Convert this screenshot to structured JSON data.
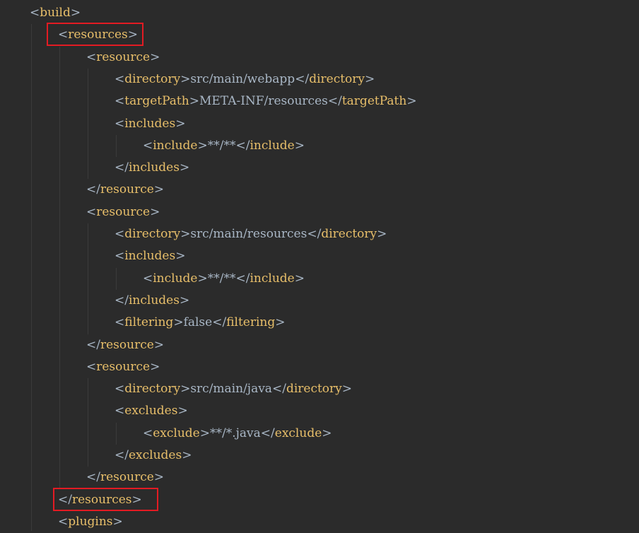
{
  "editor": {
    "lines": [
      {
        "indent": 0,
        "open": "<",
        "tag": "build",
        "close": ">",
        "text": "",
        "end_open": "",
        "end_tag": "",
        "end_close": ""
      },
      {
        "indent": 1,
        "open": "<",
        "tag": "resources",
        "close": ">",
        "text": "",
        "end_open": "",
        "end_tag": "",
        "end_close": ""
      },
      {
        "indent": 2,
        "open": "<",
        "tag": "resource",
        "close": ">",
        "text": "",
        "end_open": "",
        "end_tag": "",
        "end_close": ""
      },
      {
        "indent": 3,
        "open": "<",
        "tag": "directory",
        "close": ">",
        "text": "src/main/webapp",
        "end_open": "</",
        "end_tag": "directory",
        "end_close": ">"
      },
      {
        "indent": 3,
        "open": "<",
        "tag": "targetPath",
        "close": ">",
        "text": "META-INF/resources",
        "end_open": "</",
        "end_tag": "targetPath",
        "end_close": ">"
      },
      {
        "indent": 3,
        "open": "<",
        "tag": "includes",
        "close": ">",
        "text": "",
        "end_open": "",
        "end_tag": "",
        "end_close": ""
      },
      {
        "indent": 4,
        "open": "<",
        "tag": "include",
        "close": ">",
        "text": "**/**",
        "end_open": "</",
        "end_tag": "include",
        "end_close": ">"
      },
      {
        "indent": 3,
        "open": "</",
        "tag": "includes",
        "close": ">",
        "text": "",
        "end_open": "",
        "end_tag": "",
        "end_close": ""
      },
      {
        "indent": 2,
        "open": "</",
        "tag": "resource",
        "close": ">",
        "text": "",
        "end_open": "",
        "end_tag": "",
        "end_close": ""
      },
      {
        "indent": 2,
        "open": "<",
        "tag": "resource",
        "close": ">",
        "text": "",
        "end_open": "",
        "end_tag": "",
        "end_close": ""
      },
      {
        "indent": 3,
        "open": "<",
        "tag": "directory",
        "close": ">",
        "text": "src/main/resources",
        "end_open": "</",
        "end_tag": "directory",
        "end_close": ">"
      },
      {
        "indent": 3,
        "open": "<",
        "tag": "includes",
        "close": ">",
        "text": "",
        "end_open": "",
        "end_tag": "",
        "end_close": ""
      },
      {
        "indent": 4,
        "open": "<",
        "tag": "include",
        "close": ">",
        "text": "**/**",
        "end_open": "</",
        "end_tag": "include",
        "end_close": ">"
      },
      {
        "indent": 3,
        "open": "</",
        "tag": "includes",
        "close": ">",
        "text": "",
        "end_open": "",
        "end_tag": "",
        "end_close": ""
      },
      {
        "indent": 3,
        "open": "<",
        "tag": "filtering",
        "close": ">",
        "text": "false",
        "end_open": "</",
        "end_tag": "filtering",
        "end_close": ">"
      },
      {
        "indent": 2,
        "open": "</",
        "tag": "resource",
        "close": ">",
        "text": "",
        "end_open": "",
        "end_tag": "",
        "end_close": ""
      },
      {
        "indent": 2,
        "open": "<",
        "tag": "resource",
        "close": ">",
        "text": "",
        "end_open": "",
        "end_tag": "",
        "end_close": ""
      },
      {
        "indent": 3,
        "open": "<",
        "tag": "directory",
        "close": ">",
        "text": "src/main/java",
        "end_open": "</",
        "end_tag": "directory",
        "end_close": ">"
      },
      {
        "indent": 3,
        "open": "<",
        "tag": "excludes",
        "close": ">",
        "text": "",
        "end_open": "",
        "end_tag": "",
        "end_close": ""
      },
      {
        "indent": 4,
        "open": "<",
        "tag": "exclude",
        "close": ">",
        "text": "**/*.java",
        "end_open": "</",
        "end_tag": "exclude",
        "end_close": ">"
      },
      {
        "indent": 3,
        "open": "</",
        "tag": "excludes",
        "close": ">",
        "text": "",
        "end_open": "",
        "end_tag": "",
        "end_close": ""
      },
      {
        "indent": 2,
        "open": "</",
        "tag": "resource",
        "close": ">",
        "text": "",
        "end_open": "",
        "end_tag": "",
        "end_close": ""
      },
      {
        "indent": 1,
        "open": "</",
        "tag": "resources",
        "close": ">",
        "text": "",
        "end_open": "",
        "end_tag": "",
        "end_close": ""
      },
      {
        "indent": 1,
        "open": "<",
        "tag": "plugins",
        "close": ">",
        "text": "",
        "end_open": "",
        "end_tag": "",
        "end_close": ""
      }
    ],
    "highlighted_lines": [
      1,
      22
    ]
  },
  "colors": {
    "background": "#2b2b2b",
    "tag": "#e8bf6a",
    "bracket": "#a9b7c6",
    "text": "#a9b7c6",
    "highlight_border": "#e31b23",
    "indent_guide": "#3b3b3b"
  }
}
